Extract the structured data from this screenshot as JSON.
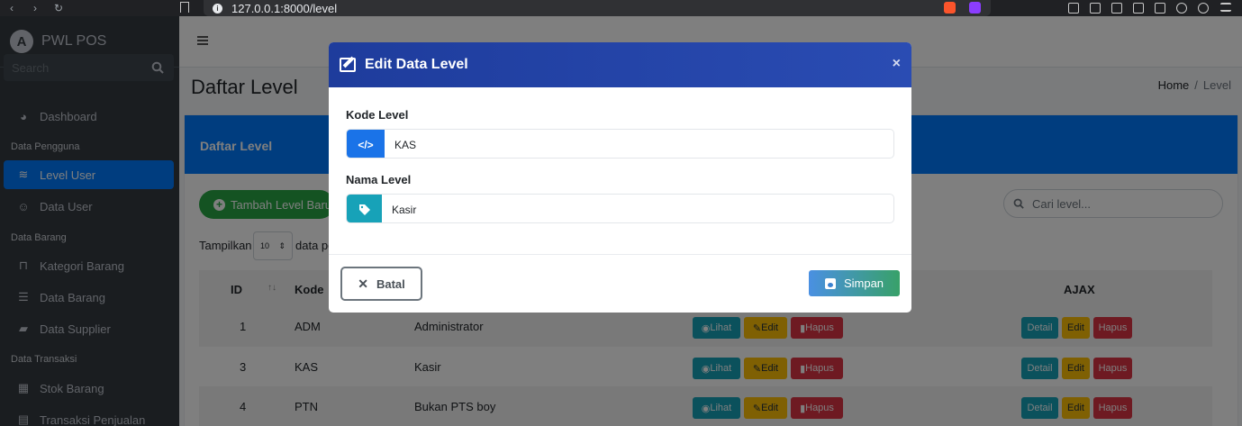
{
  "browser": {
    "url": "127.0.0.1:8000/level"
  },
  "sidebar": {
    "brand": "PWL POS",
    "search_placeholder": "Search",
    "items": [
      {
        "label": "Dashboard",
        "icon": "tachometer-icon"
      },
      {
        "header": "Data Pengguna"
      },
      {
        "label": "Level User",
        "icon": "layers-icon",
        "active": true
      },
      {
        "label": "Data User",
        "icon": "user-icon"
      },
      {
        "header": "Data Barang"
      },
      {
        "label": "Kategori Barang",
        "icon": "bookmark-icon"
      },
      {
        "label": "Data Barang",
        "icon": "list-icon"
      },
      {
        "label": "Data Supplier",
        "icon": "truck-icon"
      },
      {
        "header": "Data Transaksi"
      },
      {
        "label": "Stok Barang",
        "icon": "cubes-icon"
      },
      {
        "label": "Transaksi Penjualan",
        "icon": "cash-register-icon"
      }
    ]
  },
  "page": {
    "title": "Daftar Level",
    "breadcrumb": [
      "Home",
      "Level"
    ]
  },
  "card": {
    "header": "Daftar Level",
    "add_button": "Tambah Level Baru",
    "show_label": "Tampilkan",
    "page_size": "10",
    "after_select": "data pe",
    "search_placeholder": "Cari level...",
    "columns": [
      "ID",
      "Kode",
      "AJAX"
    ],
    "rows": [
      {
        "id": "1",
        "kode": "ADM",
        "nama": "Administrator"
      },
      {
        "id": "3",
        "kode": "KAS",
        "nama": "Kasir"
      },
      {
        "id": "4",
        "kode": "PTN",
        "nama": "Bukan PTS boy"
      }
    ],
    "action_labels": {
      "lihat": "Lihat",
      "edit": "Edit",
      "hapus": "Hapus",
      "detail": "Detail"
    }
  },
  "modal": {
    "title": "Edit Data Level",
    "close": "×",
    "kode_label": "Kode Level",
    "kode_value": "KAS",
    "nama_label": "Nama Level",
    "nama_value": "Kasir",
    "cancel": "Batal",
    "save": "Simpan"
  },
  "colors": {
    "primary": "#007bff",
    "success": "#28a745",
    "info": "#17a2b8",
    "warning": "#ffc107",
    "danger": "#dc3545",
    "modal_header": "#2a4cb3"
  }
}
